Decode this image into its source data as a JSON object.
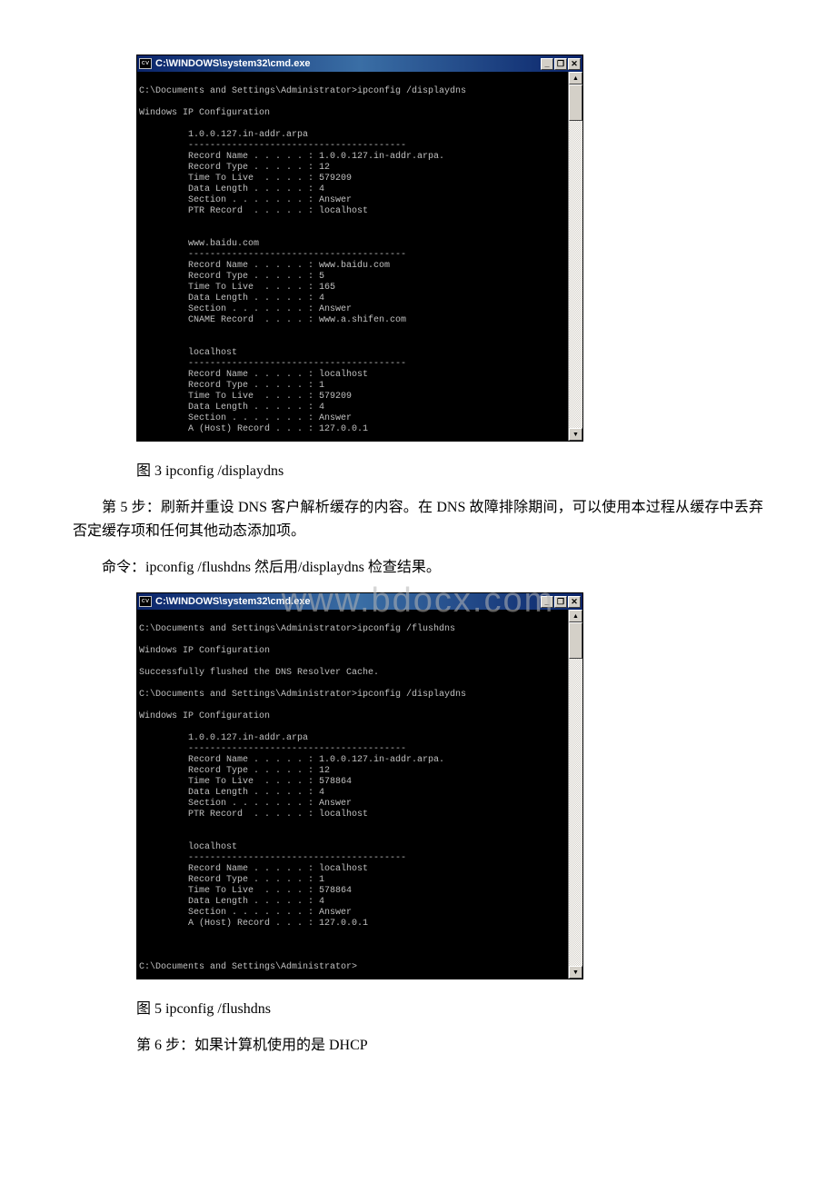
{
  "watermark": "www.bdocx.com",
  "window1": {
    "title": "C:\\WINDOWS\\system32\\cmd.exe",
    "icon_label": "cv",
    "body": "\nC:\\Documents and Settings\\Administrator>ipconfig /displaydns\n\nWindows IP Configuration\n\n         1.0.0.127.in-addr.arpa\n         ----------------------------------------\n         Record Name . . . . . : 1.0.0.127.in-addr.arpa.\n         Record Type . . . . . : 12\n         Time To Live  . . . . : 579209\n         Data Length . . . . . : 4\n         Section . . . . . . . : Answer\n         PTR Record  . . . . . : localhost\n\n\n         www.baidu.com\n         ----------------------------------------\n         Record Name . . . . . : www.baidu.com\n         Record Type . . . . . : 5\n         Time To Live  . . . . : 165\n         Data Length . . . . . : 4\n         Section . . . . . . . : Answer\n         CNAME Record  . . . . : www.a.shifen.com\n\n\n         localhost\n         ----------------------------------------\n         Record Name . . . . . : localhost\n         Record Type . . . . . : 1\n         Time To Live  . . . . : 579209\n         Data Length . . . . . : 4\n         Section . . . . . . . : Answer\n         A (Host) Record . . . : 127.0.0.1\n"
  },
  "caption1": "图 3 ipconfig /displaydns",
  "para_step5": "第 5 步：刷新并重设 DNS 客户解析缓存的内容。在 DNS 故障排除期间，可以使用本过程从缓存中丢弃否定缓存项和任何其他动态添加项。",
  "para_cmd": "命令：ipconfig /flushdns 然后用/displaydns 检查结果。",
  "window2": {
    "title": "C:\\WINDOWS\\system32\\cmd.exe",
    "icon_label": "cv",
    "body": "\nC:\\Documents and Settings\\Administrator>ipconfig /flushdns\n\nWindows IP Configuration\n\nSuccessfully flushed the DNS Resolver Cache.\n\nC:\\Documents and Settings\\Administrator>ipconfig /displaydns\n\nWindows IP Configuration\n\n         1.0.0.127.in-addr.arpa\n         ----------------------------------------\n         Record Name . . . . . : 1.0.0.127.in-addr.arpa.\n         Record Type . . . . . : 12\n         Time To Live  . . . . : 578864\n         Data Length . . . . . : 4\n         Section . . . . . . . : Answer\n         PTR Record  . . . . . : localhost\n\n\n         localhost\n         ----------------------------------------\n         Record Name . . . . . : localhost\n         Record Type . . . . . : 1\n         Time To Live  . . . . : 578864\n         Data Length . . . . . : 4\n         Section . . . . . . . : Answer\n         A (Host) Record . . . : 127.0.0.1\n\n\n\nC:\\Documents and Settings\\Administrator>\n"
  },
  "caption2": "图 5 ipconfig /flushdns",
  "para_step6": "第 6 步：如果计算机使用的是 DHCP",
  "btn": {
    "min": "_",
    "max": "❐",
    "close": "✕",
    "up": "▲",
    "down": "▼"
  }
}
